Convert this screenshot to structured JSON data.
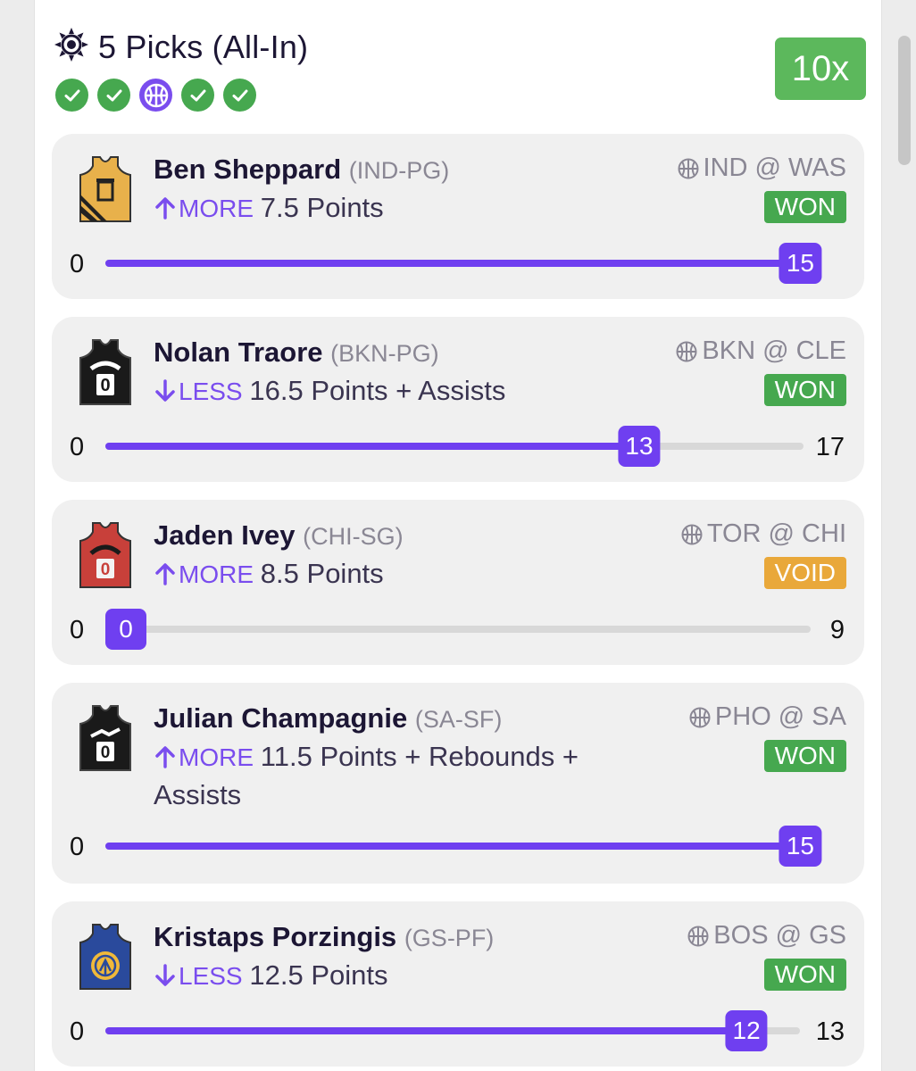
{
  "header": {
    "title": "5 Picks (All-In)",
    "multiplier": "10x",
    "statuses": [
      "check",
      "check",
      "basketball",
      "check",
      "check"
    ]
  },
  "colors": {
    "accent": "#6f3ff0",
    "won": "#46a84f",
    "void": "#e9a83a",
    "multiplier": "#5cb85c"
  },
  "picks": [
    {
      "name": "Ben Sheppard",
      "tag": "(IND-PG)",
      "direction": "MORE",
      "line": "7.5",
      "stat": "Points",
      "game": "IND @ WAS",
      "status": "WON",
      "min": "0",
      "max": "",
      "current": "15",
      "progress": 1.0,
      "jersey": {
        "color": "#e8b14b",
        "number": "0",
        "icon": "jersey-icon"
      }
    },
    {
      "name": "Nolan Traore",
      "tag": "(BKN-PG)",
      "direction": "LESS",
      "line": "16.5",
      "stat": "Points + Assists",
      "game": "BKN @ CLE",
      "status": "WON",
      "min": "0",
      "max": "17",
      "current": "13",
      "progress": 0.7647,
      "jersey": {
        "color": "#1a1a1a",
        "number": "0",
        "icon": "jersey-icon"
      }
    },
    {
      "name": "Jaden Ivey",
      "tag": "(CHI-SG)",
      "direction": "MORE",
      "line": "8.5",
      "stat": "Points",
      "game": "TOR @ CHI",
      "status": "VOID",
      "min": "0",
      "max": "9",
      "current": "0",
      "progress": 0.0,
      "jersey": {
        "color": "#c8403a",
        "number": "0",
        "icon": "jersey-icon"
      }
    },
    {
      "name": "Julian Champagnie",
      "tag": "(SA-SF)",
      "direction": "MORE",
      "line": "11.5",
      "stat": "Points + Rebounds + Assists",
      "game": "PHO @ SA",
      "status": "WON",
      "min": "0",
      "max": "",
      "current": "15",
      "progress": 1.0,
      "jersey": {
        "color": "#1a1a1a",
        "number": "0",
        "icon": "jersey-icon"
      }
    },
    {
      "name": "Kristaps Porzingis",
      "tag": "(GS-PF)",
      "direction": "LESS",
      "line": "12.5",
      "stat": "Points",
      "game": "BOS @ GS",
      "status": "WON",
      "min": "0",
      "max": "13",
      "current": "12",
      "progress": 0.923,
      "jersey": {
        "color": "#2a4a9c",
        "number": "",
        "icon": "jersey-icon"
      }
    }
  ]
}
